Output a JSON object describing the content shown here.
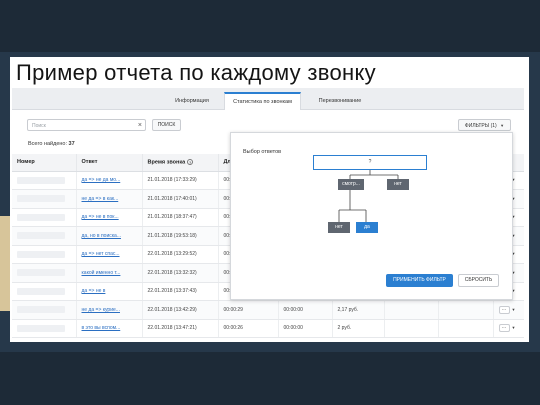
{
  "slide": {
    "title": "Пример отчета по каждому звонку"
  },
  "tabs": [
    {
      "label": "Информация",
      "active": false
    },
    {
      "label": "Статистика по звонкам",
      "active": true
    },
    {
      "label": "Перезвонивание",
      "active": false
    }
  ],
  "search": {
    "placeholder": "Поиск",
    "button_label": "ПОИСК"
  },
  "filters_button": {
    "label": "ФИЛЬТРЫ (1)"
  },
  "found": {
    "label": "Всего найдено:",
    "count": "37"
  },
  "table": {
    "columns": [
      "Номер",
      "Ответ",
      "Время звонка",
      "Дл"
    ],
    "rows": [
      {
        "answer": "да => не да мо...",
        "time": "21.01.2018 (17:33:29)",
        "dur": "00:0"
      },
      {
        "answer": "не да => в как...",
        "time": "21.01.2018 (17:40:01)",
        "dur": "00:0"
      },
      {
        "answer": "да => не в пок...",
        "time": "21.01.2018 (18:37:47)",
        "dur": "00:0"
      },
      {
        "answer": "да, но в поиска...",
        "time": "21.01.2018 (19:53:18)",
        "dur": "00:0"
      },
      {
        "answer": "да => нет спас...",
        "time": "22.01.2018 (13:29:52)",
        "dur": "00:0"
      },
      {
        "answer": "какой именно т...",
        "time": "22.01.2018 (13:32:32)",
        "dur": "00:0"
      },
      {
        "answer": "да => не в",
        "time": "22.01.2018 (13:37:43)",
        "dur": "00:0"
      },
      {
        "answer": "не да => курие...",
        "time": "22.01.2018 (13:42:29)",
        "dur": "00:00:29",
        "extra1": "00:00:00",
        "cost": "2,17 руб."
      },
      {
        "answer": "в это вы вспом...",
        "time": "22.01.2018 (13:47:21)",
        "dur": "00:00:26",
        "extra1": "00:00:00",
        "cost": "2 руб."
      }
    ]
  },
  "filter_popup": {
    "title": "Выбор ответов",
    "root": "?",
    "nodes": {
      "left": "смотр...",
      "right": "нет",
      "leaf_left": "нет",
      "leaf_right": "да"
    },
    "apply_label": "ПРИМЕНИТЬ ФИЛЬТР",
    "reset_label": "СБРОСИТЬ"
  },
  "colors": {
    "accent": "#2b7fd1",
    "node_gray": "#5f6670",
    "link": "#2b6fc2"
  }
}
